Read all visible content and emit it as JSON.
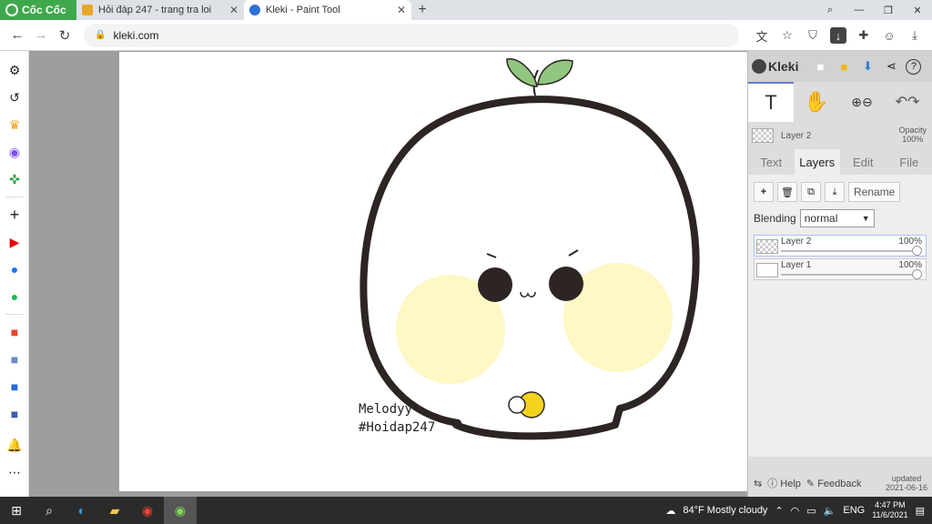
{
  "browser": {
    "brand": "Cốc Cốc",
    "tabs": [
      {
        "title": "Hỏi đáp 247 - trang tra loi",
        "active": false
      },
      {
        "title": "Kleki - Paint Tool",
        "active": true
      }
    ],
    "url": "kleki.com"
  },
  "artwork": {
    "caption_line1": "Melodyy",
    "caption_line2": "#Hoidap247"
  },
  "kleki": {
    "logo": "Kleki",
    "current_layer": "Layer 2",
    "opacity_label": "Opacity",
    "opacity_value": "100%",
    "tabs": [
      "Text",
      "Layers",
      "Edit",
      "File"
    ],
    "selected_tab": "Layers",
    "rename_label": "Rename",
    "blending_label": "Blending",
    "blending_value": "normal",
    "layers": [
      {
        "name": "Layer 2",
        "opacity": "100%",
        "active": true
      },
      {
        "name": "Layer 1",
        "opacity": "100%",
        "active": false
      }
    ],
    "help_label": "Help",
    "feedback_label": "Feedback",
    "updated_label": "updated",
    "updated_date": "2021-06-16"
  },
  "taskbar": {
    "weather": "84°F  Mostly cloudy",
    "lang": "ENG",
    "time": "4:47 PM",
    "date": "11/6/2021"
  },
  "colors": {
    "browser_brand": "#3fa84a",
    "kleki_accent": "#5b7fcf",
    "blush": "#fdf8c4",
    "outline": "#2d2424",
    "sprout": "#8fc77e"
  }
}
